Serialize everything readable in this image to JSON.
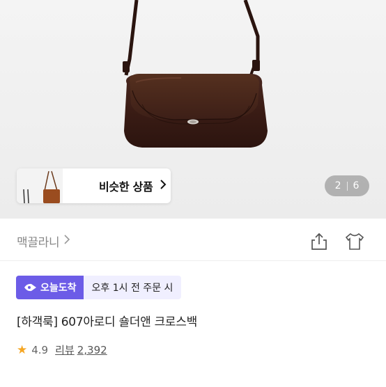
{
  "gallery": {
    "current": "2",
    "total": "6",
    "similar_label": "비슷한 상품"
  },
  "brand": {
    "name": "맥끌라니"
  },
  "delivery": {
    "badge_label": "오늘도착",
    "condition": "오후 1시 전 주문 시"
  },
  "product": {
    "title": "[하객룩] 607아로디 숄더앤 크로스백",
    "rating": "4.9",
    "review_label": "리뷰",
    "review_count": "2,392"
  },
  "colors": {
    "accent": "#6c5ce7",
    "star": "#f5a623",
    "bag": "#3b1d16"
  },
  "icons": [
    "share-icon",
    "wishlist-icon",
    "chevron-right-icon",
    "star-icon",
    "delivery-icon"
  ]
}
